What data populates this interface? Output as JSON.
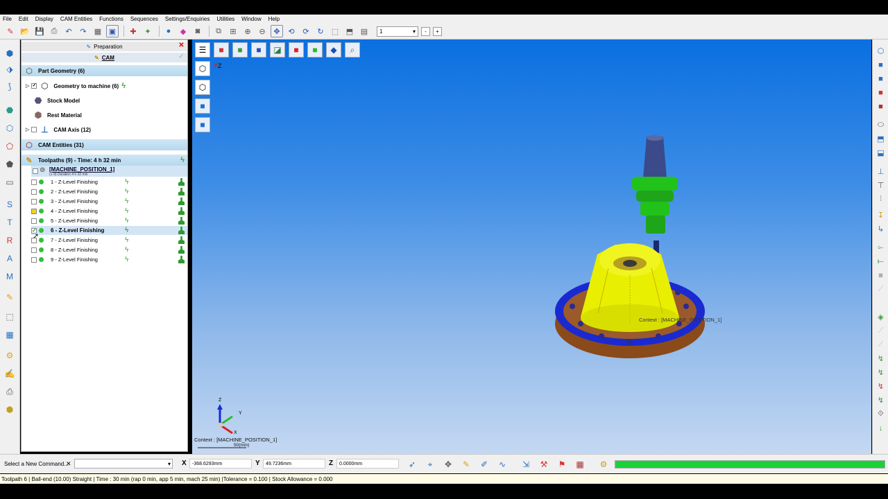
{
  "menu": [
    "File",
    "Edit",
    "Display",
    "CAM Entities",
    "Functions",
    "Sequences",
    "Settings/Enquiries",
    "Utilities",
    "Window",
    "Help"
  ],
  "toolbar": {
    "combo_value": "1",
    "minus": "-",
    "plus": "+"
  },
  "panel": {
    "tab_preparation": "Preparation",
    "tab_cam": "CAM",
    "part_geometry": "Part Geometry (6)",
    "geometry_to_machine": "Geometry to machine (6)",
    "stock_model": "Stock Model",
    "rest_material": "Rest Material",
    "cam_axis": "CAM Axis (12)",
    "cam_entities": "CAM Entities (31)",
    "toolpaths": "Toolpaths (9) - Time: 4 h 32 min",
    "machine_position": "[MACHINE_POSITION_1]",
    "machine_duration": "(1-9) Duration 4 h 32 min",
    "rows": [
      {
        "label": "1 - Z-Level Finishing",
        "checked": false
      },
      {
        "label": "2 - Z-Level Finishing",
        "checked": false
      },
      {
        "label": "3 - Z-Level Finishing",
        "checked": false
      },
      {
        "label": "4 - Z-Level Finishing",
        "checked": false
      },
      {
        "label": "5 - Z-Level Finishing",
        "checked": false
      },
      {
        "label": "6 - Z-Level Finishing",
        "checked": true
      },
      {
        "label": "7 - Z-Level Finishing",
        "checked": false
      },
      {
        "label": "8 - Z-Level Finishing",
        "checked": false
      },
      {
        "label": "9 - Z-Level Finishing",
        "checked": false
      }
    ]
  },
  "viewport": {
    "context_label": "Context : [MACHINE_POSITION_1]",
    "scale_label": "50(mm)",
    "model_context": "Context : [MACHINE_POSITION_1]",
    "axis_z": "Z",
    "axis_y": "Y",
    "axis_x": "X",
    "yz_label": "Y",
    "yz_label2": "Z"
  },
  "cmdbar": {
    "label": "Select a New Command...",
    "x_label": "X",
    "x_value": "-368.6293mm",
    "y_label": "Y",
    "y_value": "49.7236mm",
    "z_label": "Z",
    "z_value": "0.0000mm",
    "progress": 1.0
  },
  "status": "Toolpath 6 | Ball-end (10.00) Straight | Time : 30 min (rap 0 min, app 5 min, mach 25 min) |Tolerance = 0.100 | Stock Allowance = 0.000"
}
